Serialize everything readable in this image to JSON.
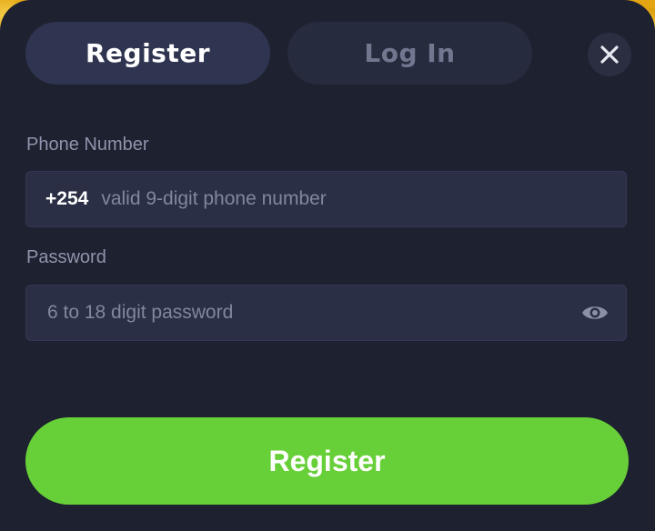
{
  "tabs": {
    "register_label": "Register",
    "login_label": "Log In"
  },
  "close": {
    "icon": "close-icon"
  },
  "phone": {
    "label": "Phone Number",
    "prefix": "+254",
    "placeholder": "valid 9-digit phone number",
    "value": ""
  },
  "password": {
    "label": "Password",
    "placeholder": "6 to 18 digit password",
    "value": "",
    "toggle_icon": "eye-icon"
  },
  "submit": {
    "label": "Register"
  },
  "colors": {
    "accent": "#67cf38",
    "panel": "#1e2130",
    "field": "#2a2f45",
    "active_tab": "#2f3550",
    "inactive_tab": "#272b3e",
    "backdrop": "#e2a612"
  }
}
